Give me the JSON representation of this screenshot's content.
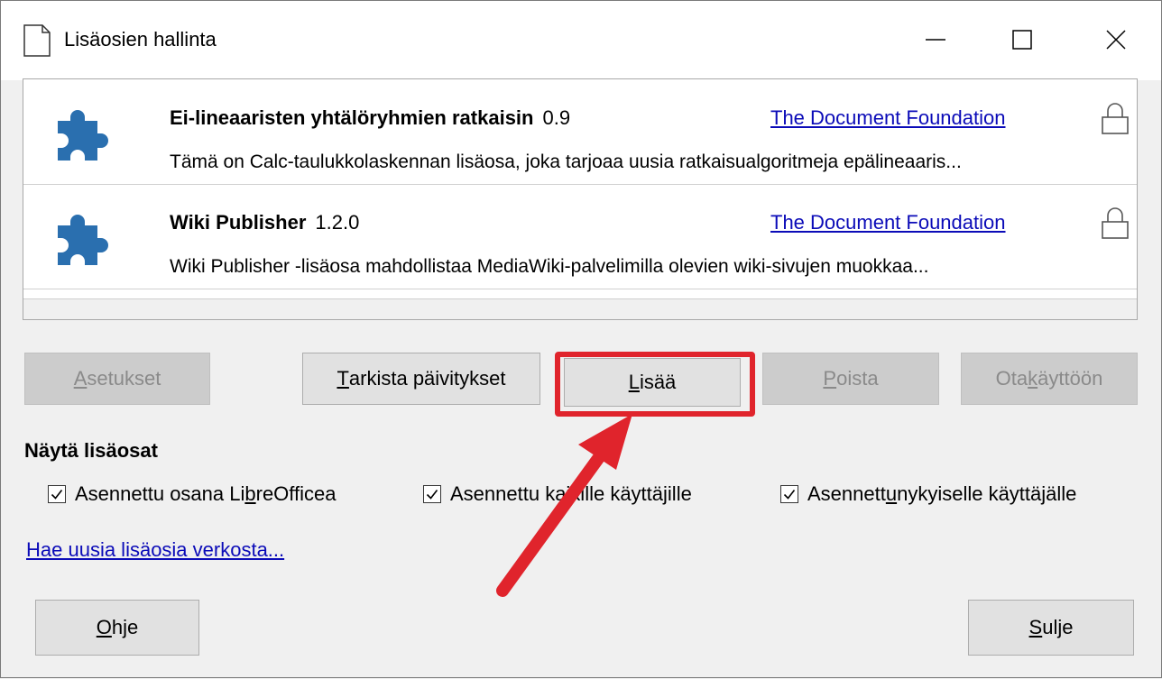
{
  "window": {
    "title": "Lisäosien hallinta",
    "minimize_label": "Minimize",
    "maximize_label": "Maximize",
    "close_label": "Close"
  },
  "extensions": [
    {
      "name": "Ei-lineaaristen yhtälöryhmien ratkaisin",
      "version": "0.9",
      "publisher": "The Document Foundation",
      "description": "Tämä on Calc-taulukkolaskennan lisäosa, joka tarjoaa uusia ratkaisualgoritmeja epälineaaris...",
      "icon": "puzzle-icon",
      "lock_icon": "lock-icon"
    },
    {
      "name": "Wiki Publisher",
      "version": "1.2.0",
      "publisher": "The Document Foundation",
      "description": "Wiki Publisher -lisäosa mahdollistaa MediaWiki-palvelimilla olevien wiki-sivujen muokkaa...",
      "icon": "puzzle-icon",
      "lock_icon": "lock-icon"
    }
  ],
  "buttons": {
    "options": {
      "pre": "",
      "mn": "A",
      "post": "setukset",
      "enabled": false
    },
    "check_updates": {
      "pre": "",
      "mn": "T",
      "post": "arkista päivitykset",
      "enabled": true
    },
    "add": {
      "pre": "",
      "mn": "L",
      "post": "isää",
      "enabled": true
    },
    "remove": {
      "pre": "",
      "mn": "P",
      "post": "oista",
      "enabled": false
    },
    "enable": {
      "pre": "Ota ",
      "mn": "k",
      "post": "äyttöön",
      "enabled": false
    },
    "help": {
      "pre": "",
      "mn": "O",
      "post": "hje",
      "enabled": true
    },
    "close": {
      "pre": "",
      "mn": "S",
      "post": "ulje",
      "enabled": true
    }
  },
  "show_section": {
    "title": "Näytä lisäosat",
    "checkboxes": [
      {
        "pre": "Asennettu osana Li",
        "mn": "b",
        "post": "reOfficea",
        "checked": true
      },
      {
        "pre": "Asennettu kaikille käyttä",
        "mn": "j",
        "post": "ille",
        "checked": true
      },
      {
        "pre": "Asennett",
        "mn": "u",
        "post": " nykyiselle käyttäjälle",
        "checked": true
      }
    ]
  },
  "get_more_link": "Hae uusia lisäosia verkosta...",
  "annotation": {
    "color": "#e0242c"
  }
}
